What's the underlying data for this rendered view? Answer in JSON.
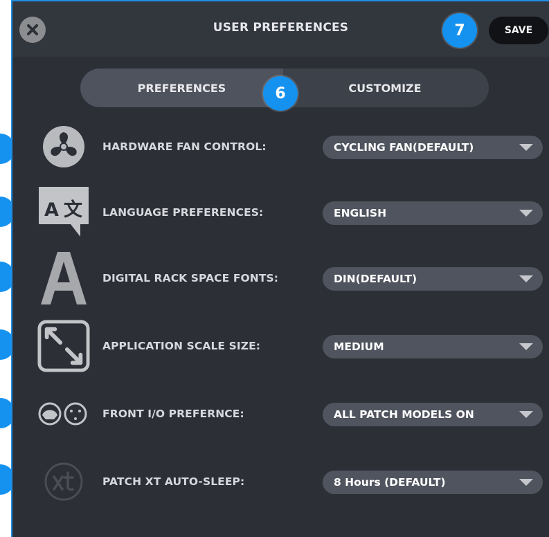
{
  "header": {
    "title": "USER PREFERENCES",
    "save_label": "SAVE",
    "close_icon": "close-icon"
  },
  "callouts": {
    "tab_callout": "6",
    "save_callout": "7"
  },
  "tabs": [
    {
      "label": "PREFERENCES",
      "active": true
    },
    {
      "label": "CUSTOMIZE",
      "active": false
    }
  ],
  "settings": [
    {
      "icon": "fan-icon",
      "label": "HARDWARE FAN CONTROL:",
      "value": "CYCLING FAN(DEFAULT)"
    },
    {
      "icon": "language-icon",
      "label": "LANGUAGE PREFERENCES:",
      "value": "ENGLISH"
    },
    {
      "icon": "font-icon",
      "label": "DIGITAL RACK SPACE FONTS:",
      "value": "DIN(DEFAULT)"
    },
    {
      "icon": "scale-icon",
      "label": "APPLICATION SCALE SIZE:",
      "value": "MEDIUM"
    },
    {
      "icon": "io-icon",
      "label": "FRONT I/O PREFERNCE:",
      "value": "ALL PATCH MODELS ON"
    },
    {
      "icon": "xt-icon",
      "label": "PATCH XT AUTO-SLEEP:",
      "value": "8 Hours (DEFAULT)"
    }
  ],
  "colors": {
    "panel_bg": "#2c2f36",
    "accent": "#1592f0",
    "dropdown_bg": "#50545e",
    "save_bg": "#111215"
  }
}
